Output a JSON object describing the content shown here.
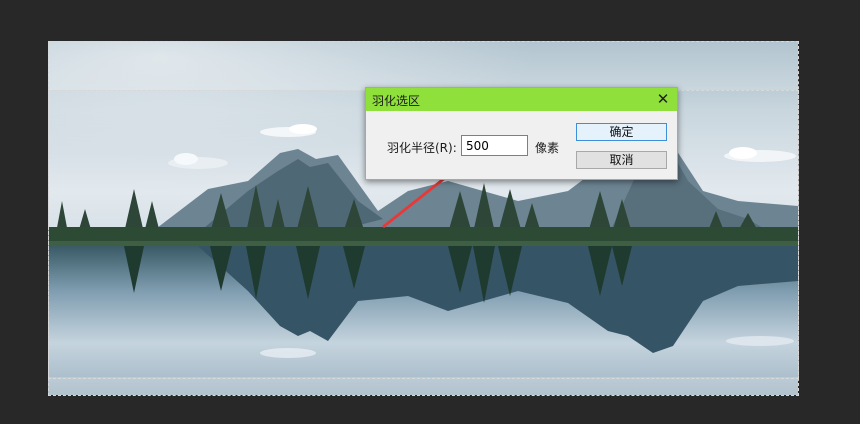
{
  "dialog": {
    "title": "羽化选区",
    "close_glyph": "✕",
    "radius_label": "羽化半径(R):",
    "radius_value": "500",
    "unit_label": "像素",
    "ok_label": "确定",
    "cancel_label": "取消"
  },
  "colors": {
    "workspace": "#282828",
    "titlebar": "#8fe03a",
    "arrow": "#e53a3a"
  }
}
